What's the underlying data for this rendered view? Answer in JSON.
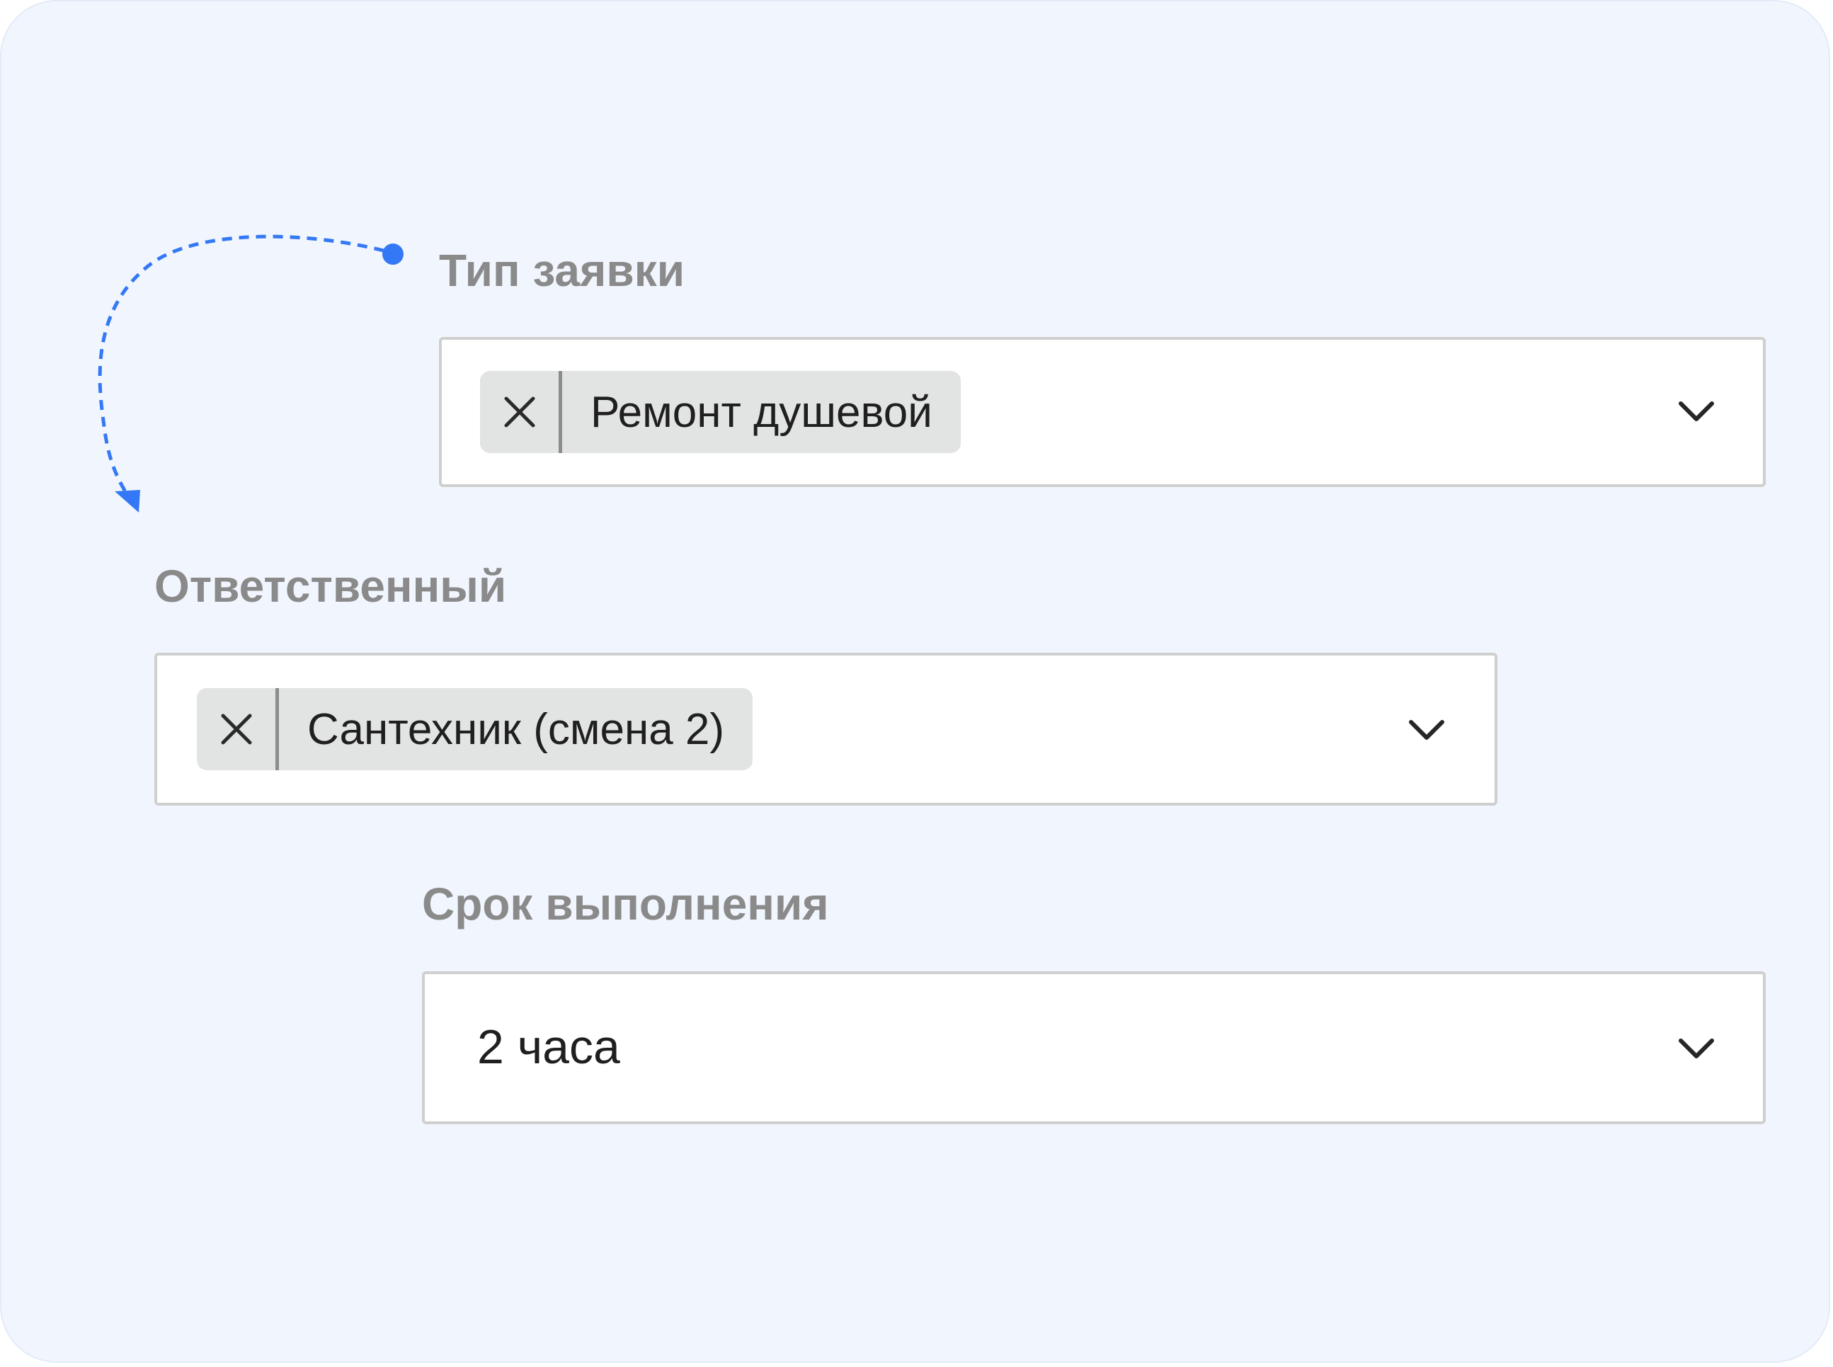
{
  "fields": [
    {
      "label": "Тип заявки",
      "chip": "Ремонт душевой"
    },
    {
      "label": "Ответственный",
      "chip": "Сантехник (смена 2)"
    },
    {
      "label": "Срок выполнения",
      "value": "2 часа"
    }
  ],
  "colors": {
    "background": "#f1f6fe",
    "accent": "#3478f6",
    "label": "#8a8a8a",
    "chip": "#e2e3e3",
    "border": "#cfcfcf"
  },
  "icons": {
    "remove": "close-icon",
    "dropdown": "chevron-down-icon"
  }
}
